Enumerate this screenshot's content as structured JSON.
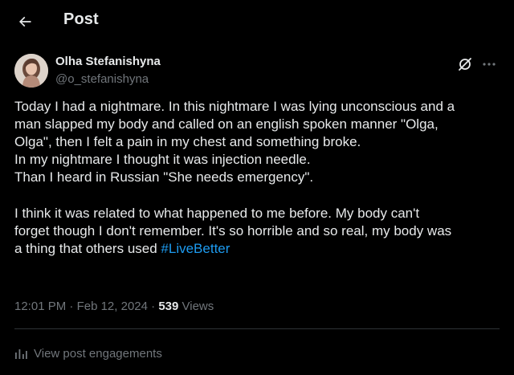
{
  "header": {
    "title": "Post",
    "back_icon": "arrow-left-icon"
  },
  "author": {
    "name": "Olha Stefanishyna",
    "handle": "@o_stefanishyna",
    "avatar_icon": "profile-photo"
  },
  "actions": {
    "grok_icon": "grok-icon",
    "more_icon": "more-horizontal-icon"
  },
  "post": {
    "lines": [
      "Today I had a nightmare. In this nightmare I was lying unconscious and a",
      "man slapped my body and called on an english spoken manner \"Olga,",
      "Olga\", then I felt a pain in my chest and something broke.",
      "In my nightmare I thought it was injection needle.",
      "Than I heard in Russian \"She needs emergency\".",
      "",
      "I think it was related to what happened to me before. My body can't",
      "forget though I don't remember. It's so horrible and so real, my body was"
    ],
    "last_line_text": "a thing that others used ",
    "hashtag": "#LiveBetter",
    "hashtag_color": "#1d9bf0"
  },
  "meta": {
    "time": "12:01 PM",
    "separator": " · ",
    "date": "Feb 12, 2024",
    "views_count": "539",
    "views_label": " Views"
  },
  "engagements": {
    "label": "View post engagements",
    "icon": "bar-chart-icon"
  },
  "colors": {
    "background": "#000000",
    "text_primary": "#e7e9ea",
    "text_secondary": "#71767b",
    "accent": "#1d9bf0",
    "divider": "#2f3336"
  }
}
